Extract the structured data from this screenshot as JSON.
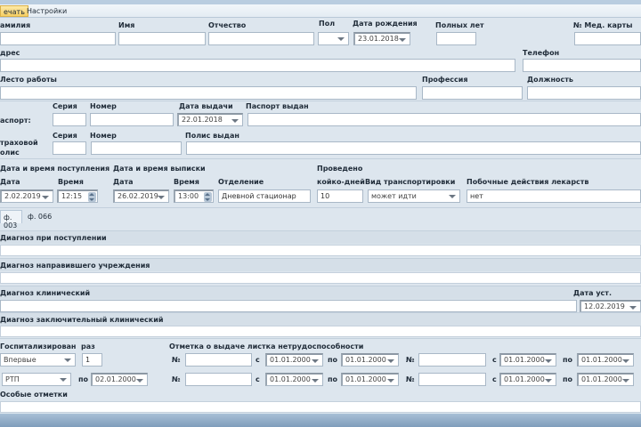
{
  "ribbon": {
    "tabs": [
      "ечать",
      "Настройки"
    ]
  },
  "patient": {
    "surname_label": "амилия",
    "name_label": "Имя",
    "patronymic_label": "Отчество",
    "sex_label": "Пол",
    "dob_label": "Дата рождения",
    "dob_value": "23.01.2018",
    "age_label": "Полных лет",
    "card_label": "№ Мед. карты",
    "address_label": "дрес",
    "phone_label": "Телефон",
    "work_label": "Лесто работы",
    "profession_label": "Профессия",
    "position_label": "Должность",
    "passport_label": "аспорт:",
    "series_label": "Серия",
    "number_label": "Номер",
    "issue_date_label": "Дата выдачи",
    "issue_date_value": "22.01.2018",
    "passport_issued_label": "Паспорт выдан",
    "insurance_label_1": "траховой",
    "insurance_label_2": "олис",
    "policy_series_label": "Серия",
    "policy_number_label": "Номер",
    "policy_issued_label": "Полис выдан"
  },
  "stay": {
    "admission_label": "Дата и время поступления",
    "discharge_label": "Дата и время выписки",
    "conducted_label": "Проведено",
    "adm_date_label": "Дата",
    "adm_time_label": "Время",
    "adm_date": "2.02.2019",
    "adm_time": "12:15",
    "dis_date_label": "Дата",
    "dis_time_label": "Время",
    "dis_date": "26.02.2019",
    "dis_time": "13:00",
    "department_label": "Отделение",
    "department": "Дневной стационар",
    "bed_days_label": "койко-дней",
    "bed_days": "10",
    "transport_label": "Вид транспортировки",
    "transport": "может идти",
    "side_effects_label": "Побочные действия лекарств",
    "side_effects": "нет"
  },
  "form_tabs": [
    "ф. 003",
    "ф. 066"
  ],
  "diagnoses": {
    "admission": "Диагноз при поступлении",
    "referring": "Диагноз направившего учреждения",
    "clinical": "Диагноз клинический",
    "set_date_label": "Дата уст.",
    "set_date": "12.02.2019",
    "final": "Диагноз заключительный клинический"
  },
  "hosp": {
    "hospitalized_label": "Госпитализирован",
    "times_label": "раз",
    "hospitalized": "Впервые",
    "times": "1",
    "type": "РТП",
    "to_label": "по",
    "to_date": "02.01.2000",
    "sick_leave_label": "Отметка о выдаче листка нетрудоспособности",
    "no_label": "№",
    "from_label": "с",
    "till_label": "по",
    "date": "01.01.2000",
    "special_label": "Особые отметки"
  }
}
